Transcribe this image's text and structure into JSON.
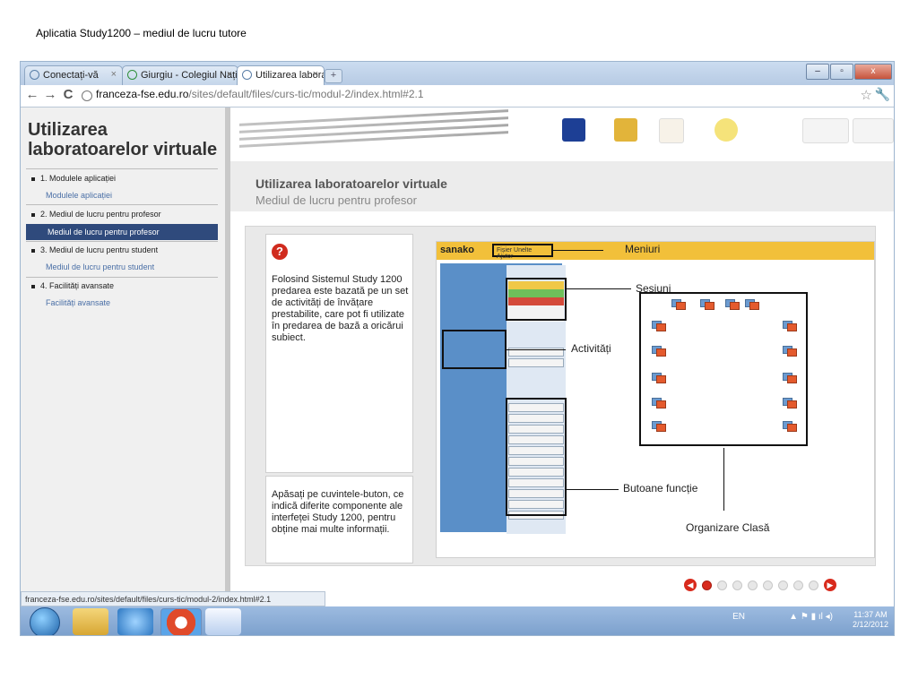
{
  "slide": {
    "title": "Aplicatia Study1200 – mediul de lucru tutore"
  },
  "browser": {
    "tabs": [
      {
        "label": "Conectați-vă",
        "close": "×"
      },
      {
        "label": "Giurgiu - Colegiul Național",
        "close": "×"
      },
      {
        "label": "Utilizarea laboratoarelor virt",
        "close": "×"
      }
    ],
    "new_tab": "+",
    "buttons": {
      "minimize": "–",
      "maximize": "▫",
      "close": "x"
    },
    "nav": {
      "back": "←",
      "forward": "→",
      "reload": "C"
    },
    "url": {
      "host": "franceza-fse.edu.ro",
      "path": "/sites/default/files/curs-tic/modul-2/index.html#2.1"
    },
    "bookmark": "☆",
    "settings": "🔧",
    "status_url": "franceza-fse.edu.ro/sites/default/files/curs-tic/modul-2/index.html#2.1"
  },
  "sidebar": {
    "title_line1": "Utilizarea",
    "title_line2": "laboratoarelor virtuale",
    "items": [
      {
        "label": "1. Modulele aplicației",
        "sub": "Modulele aplicației"
      },
      {
        "label": "2. Mediul de lucru pentru profesor",
        "sub": "Mediul de lucru pentru profesor"
      },
      {
        "label": "3. Mediul de lucru pentru student",
        "sub": "Mediul de lucru pentru student"
      },
      {
        "label": "4. Facilități avansate",
        "sub": "Facilități avansate"
      }
    ]
  },
  "header": {
    "title": "Utilizarea laboratoarelor virtuale",
    "subtitle": "Mediul de lucru pentru profesor"
  },
  "content": {
    "help_icon": "?",
    "description": "Folosind Sistemul Study 1200 predarea este bazată pe un set de activități de învățare prestabilite, care pot fi utilizate în predarea de bază a oricărui subiect.",
    "instruction": "Apăsați pe cuvintele-buton, ce indică diferite componente ale interfeței Study 1200, pentru obține mai multe informații."
  },
  "screenshot": {
    "logo": "sanako",
    "menu": "Fișier   Unelte   Ajutor",
    "callouts": {
      "menus": "Meniuri",
      "sessions": "Sesiuni",
      "activities": "Activități",
      "function_buttons": "Butoane funcție",
      "classroom": "Organizare Clasă"
    }
  },
  "taskbar": {
    "lang": "EN",
    "time": "11:37 AM",
    "date": "2/12/2012"
  },
  "colors": {
    "sidebar_active": "#2f4a7c",
    "accent_red": "#d82a1c",
    "sanako_yellow": "#f2c03a"
  }
}
